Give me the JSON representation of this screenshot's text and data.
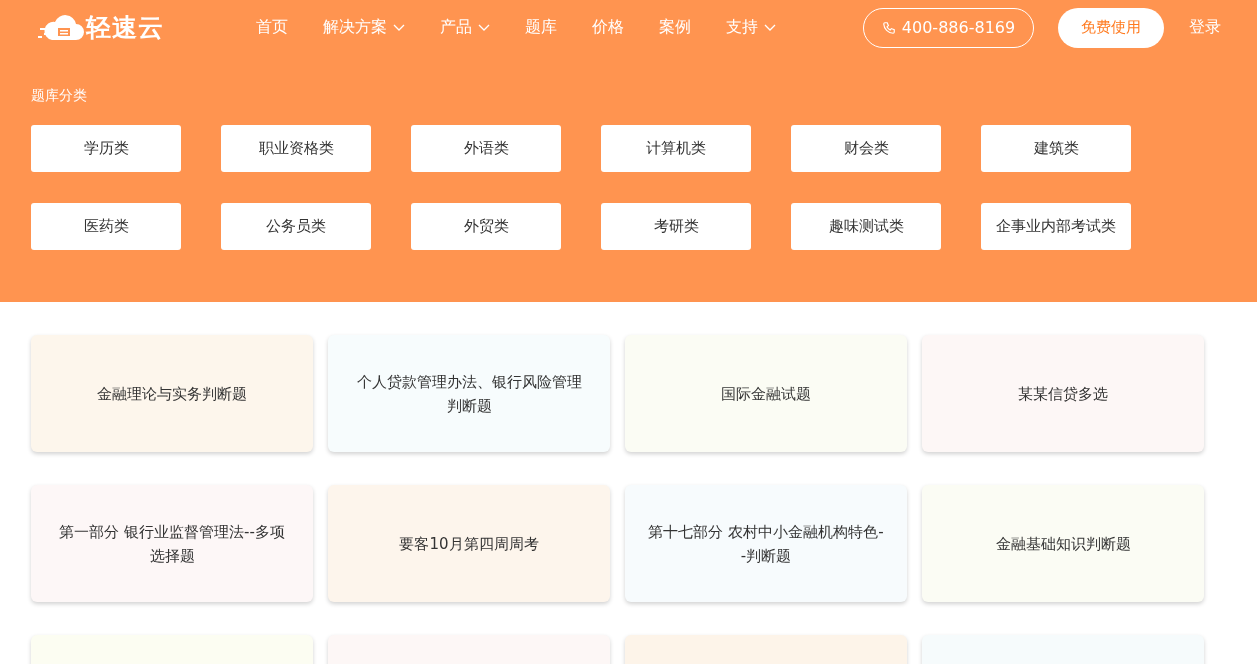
{
  "logo": {
    "text": "轻速云"
  },
  "nav": [
    {
      "label": "首页",
      "kind": "link"
    },
    {
      "label": "解决方案",
      "kind": "dropdown"
    },
    {
      "label": "产品",
      "kind": "dropdown"
    },
    {
      "label": "题库",
      "kind": "link"
    },
    {
      "label": "价格",
      "kind": "link"
    },
    {
      "label": "案例",
      "kind": "link"
    },
    {
      "label": "支持",
      "kind": "dropdown"
    }
  ],
  "phone": "400-886-8169",
  "cta": "免费使用",
  "login": "登录",
  "categories": {
    "title": "题库分类",
    "items": [
      "学历类",
      "职业资格类",
      "外语类",
      "计算机类",
      "财会类",
      "建筑类",
      "医药类",
      "公务员类",
      "外贸类",
      "考研类",
      "趣味测试类",
      "企事业内部考试类"
    ]
  },
  "cards": [
    {
      "title": "金融理论与实务判断题",
      "color": "#fdf6ec"
    },
    {
      "title": "个人贷款管理办法、银行风险管理判断题",
      "color": "#f7fcfd"
    },
    {
      "title": "国际金融试题",
      "color": "#fbfcf4"
    },
    {
      "title": "某某信贷多选",
      "color": "#fdf7f6"
    },
    {
      "title": "第一部分 银行业监督管理法--多项选择题",
      "color": "#fdf7f7"
    },
    {
      "title": "要客10月第四周周考",
      "color": "#fdf5ec"
    },
    {
      "title": "第十七部分 农村中小金融机构特色--判断题",
      "color": "#f7fbfd"
    },
    {
      "title": "金融基础知识判断题",
      "color": "#fbfcf4"
    },
    {
      "color": "#fcfdf2"
    },
    {
      "color": "#fdf7f6"
    },
    {
      "color": "#fdf4e9"
    },
    {
      "color": "#f6fbfc"
    }
  ]
}
